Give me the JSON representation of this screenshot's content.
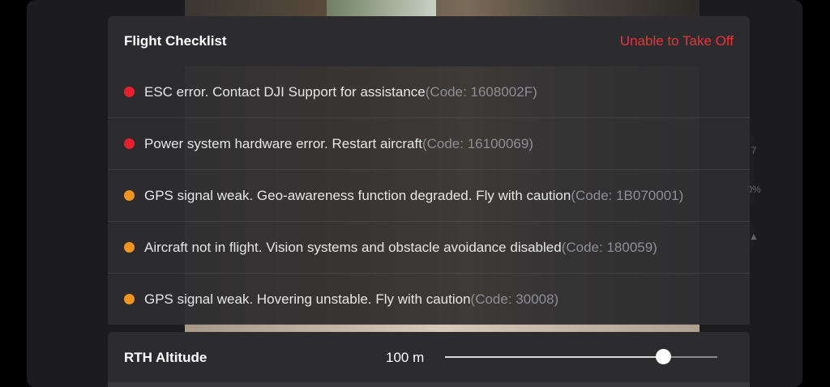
{
  "checklist": {
    "title": "Flight Checklist",
    "status": "Unable to Take Off",
    "status_color": "#e8333c",
    "items": [
      {
        "severity": "error",
        "color": "#e8202e",
        "message": "ESC error. Contact DJI Support for assistance",
        "code": "(Code: 1608002F)"
      },
      {
        "severity": "error",
        "color": "#e8202e",
        "message": "Power system hardware error. Restart aircraft",
        "code": "(Code: 16100069)"
      },
      {
        "severity": "warning",
        "color": "#f0961e",
        "message": "GPS signal weak. Geo-awareness function degraded. Fly with caution",
        "code": "(Code: 1B070001)"
      },
      {
        "severity": "warning",
        "color": "#f0961e",
        "message": "Aircraft not in flight. Vision systems and obstacle avoidance disabled",
        "code": "(Code: 180059)"
      },
      {
        "severity": "warning",
        "color": "#f0961e",
        "message": "GPS signal weak. Hovering unstable. Fly with caution",
        "code": "(Code: 30008)"
      }
    ]
  },
  "rth": {
    "label": "RTH Altitude",
    "value": "100 m",
    "slider_fraction": 0.8
  },
  "side_widgets": {
    "value_a": "7",
    "value_b": "0%",
    "icon": "mountain-icon"
  }
}
